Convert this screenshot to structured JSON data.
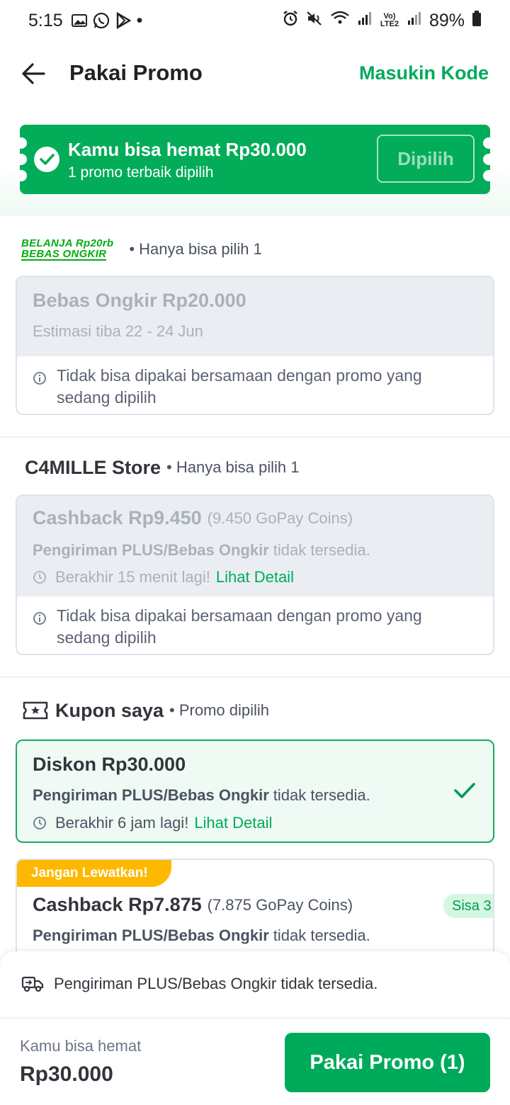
{
  "status": {
    "time": "5:15",
    "dot": "•",
    "signal_text": "Vo) LTE2",
    "battery": "89%"
  },
  "header": {
    "title": "Pakai Promo",
    "action": "Masukin Kode"
  },
  "banner": {
    "title": "Kamu bisa hemat Rp30.000",
    "subtitle": "1 promo terbaik dipilih",
    "button": "Dipilih"
  },
  "section1": {
    "logo_line1": "BELANJA Rp20rb",
    "logo_line2": "BEBAS ONGKIR",
    "note": "• Hanya bisa pilih 1",
    "card": {
      "title": "Bebas Ongkir Rp20.000",
      "estimate": "Estimasi tiba 22 - 24 Jun",
      "info": "Tidak bisa dipakai bersamaan dengan promo yang sedang dipilih"
    }
  },
  "section2": {
    "store": "C4MILLE Store",
    "note": "• Hanya bisa pilih 1",
    "card": {
      "title": "Cashback Rp9.450",
      "coins": "(9.450 GoPay Coins)",
      "ship_bold": "Pengiriman PLUS/Bebas Ongkir",
      "ship_rest": "tidak tersedia.",
      "expiry": "Berakhir 15 menit lagi!",
      "link": "Lihat Detail",
      "info": "Tidak bisa dipakai bersamaan dengan promo yang sedang dipilih"
    }
  },
  "section3": {
    "title": "Kupon saya",
    "note": "• Promo dipilih",
    "selected": {
      "title": "Diskon Rp30.000",
      "ship_bold": "Pengiriman PLUS/Bebas Ongkir",
      "ship_rest": "tidak tersedia.",
      "expiry": "Berakhir 6 jam lagi!",
      "link": "Lihat Detail"
    },
    "next": {
      "badge": "Jangan Lewatkan!",
      "title": "Cashback Rp7.875",
      "coins": "(7.875 GoPay Coins)",
      "sisa": "Sisa 3",
      "ship_bold": "Pengiriman PLUS/Bebas Ongkir",
      "ship_rest": "tidak tersedia."
    }
  },
  "shipping_notice": "Pengiriman PLUS/Bebas Ongkir tidak tersedia.",
  "footer": {
    "label": "Kamu bisa hemat",
    "amount": "Rp30.000",
    "button": "Pakai Promo (1)"
  },
  "colors": {
    "brand_green": "#00aa5b",
    "badge_orange": "#ffb800"
  }
}
